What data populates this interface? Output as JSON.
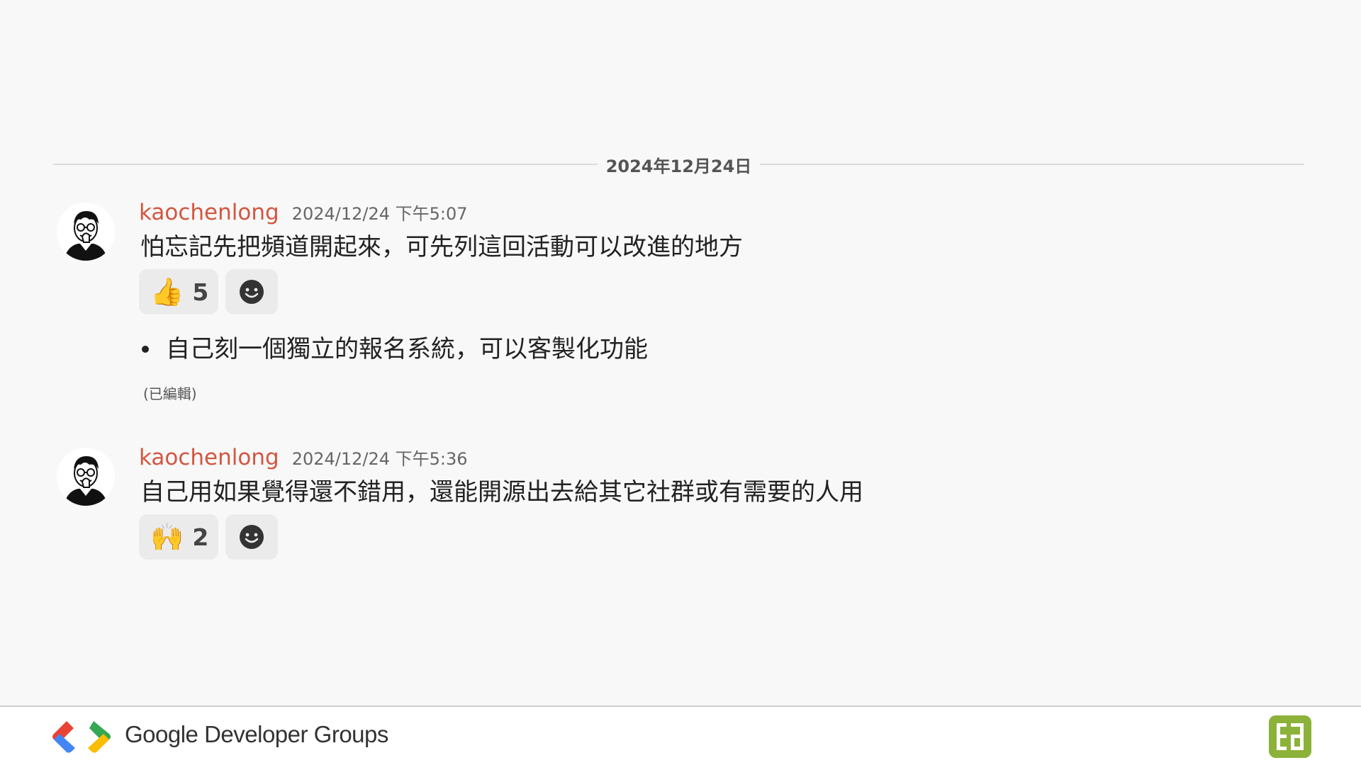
{
  "date_divider": "2024年12月24日",
  "messages": [
    {
      "username": "kaochenlong",
      "timestamp": "2024/12/24 下午5:07",
      "text": "怕忘記先把頻道開起來，可先列這回活動可以改進的地方",
      "reaction": {
        "emoji": "👍",
        "emoji_name": "thumbs-up",
        "count": "5"
      },
      "bullets": [
        "自己刻一個獨立的報名系統，可以客製化功能"
      ],
      "edited": "(已編輯)"
    },
    {
      "username": "kaochenlong",
      "timestamp": "2024/12/24 下午5:36",
      "text": "自己用如果覺得還不錯用，還能開源出去給其它社群或有需要的人用",
      "reaction": {
        "emoji": "🙌",
        "emoji_name": "raising-hands",
        "count": "2"
      }
    }
  ],
  "add_reaction_icon": "smiley-icon",
  "footer": {
    "brand_name": "Google Developer Groups",
    "badge_icon": "community-badge-icon"
  },
  "colors": {
    "background": "#f8f8f8",
    "username": "#d4563f",
    "reaction_bg": "#ebebeb",
    "badge": "#8cb23a",
    "gdg_blue": "#4285f4",
    "gdg_red": "#ea4335",
    "gdg_green": "#34a853",
    "gdg_yellow": "#fbbc04"
  }
}
